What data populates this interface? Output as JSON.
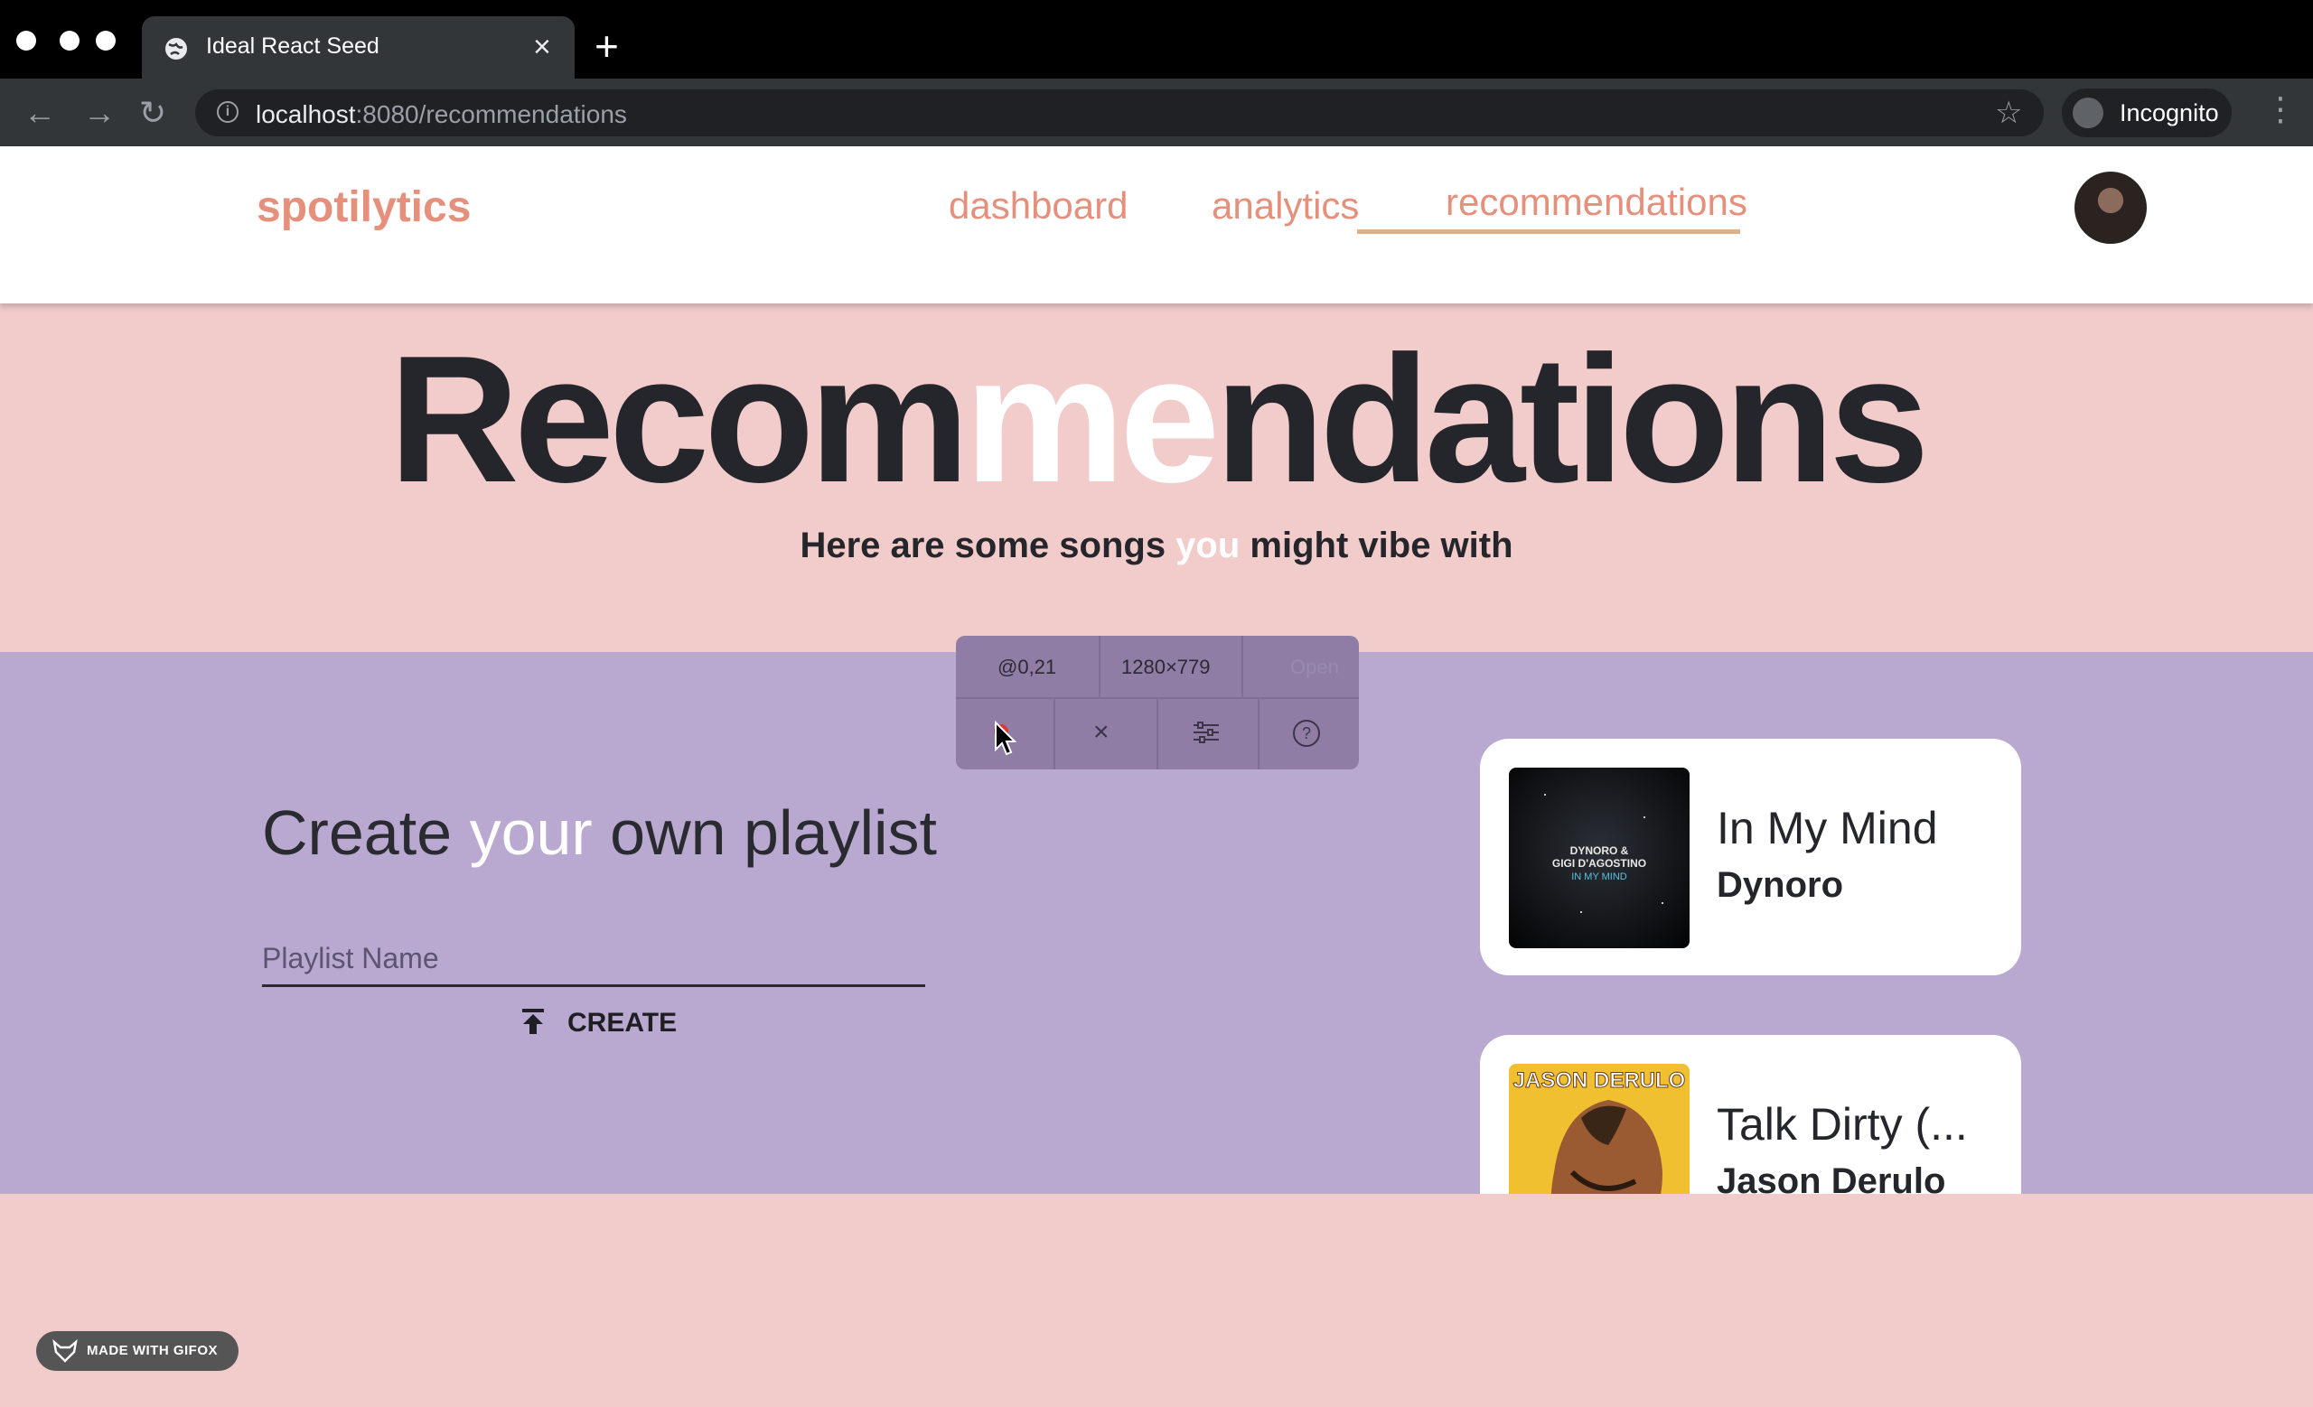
{
  "browser": {
    "tab_title": "Ideal React Seed",
    "url_host": "localhost",
    "url_path": ":8080/recommendations",
    "profile_label": "Incognito"
  },
  "app": {
    "brand": "spotilytics",
    "nav": [
      {
        "label": "dashboard"
      },
      {
        "label": "analytics"
      },
      {
        "label": "recommendations",
        "active": true
      }
    ]
  },
  "hero": {
    "title_part1": "Recom",
    "title_highlight": "me",
    "title_part2": "ndations",
    "subtitle_part1": "Here are some songs ",
    "subtitle_highlight": "you",
    "subtitle_part2": " might vibe with"
  },
  "playlist": {
    "title_part1": "Create ",
    "title_highlight": "your",
    "title_part2": " own playlist",
    "input_placeholder": "Playlist Name",
    "create_label": "CREATE"
  },
  "songs": [
    {
      "title": "In My Mind",
      "artist": "Dynoro",
      "cover_text": "DYNORO & GIGI D'AGOSTINO IN MY MIND"
    },
    {
      "title": "Talk Dirty (...",
      "artist": "Jason Derulo",
      "cover_text": "JASON DERULO"
    }
  ],
  "capture_overlay": {
    "position": "@0,21",
    "size": "1280×779",
    "extra": "Open"
  },
  "watermark": "MADE WITH GIFOX",
  "colors": {
    "accent": "#e5907d",
    "underline": "#ddb08c",
    "page_bg": "#f2cbcb",
    "band_bg": "#b9a8cf",
    "dark_text": "#25262b"
  }
}
